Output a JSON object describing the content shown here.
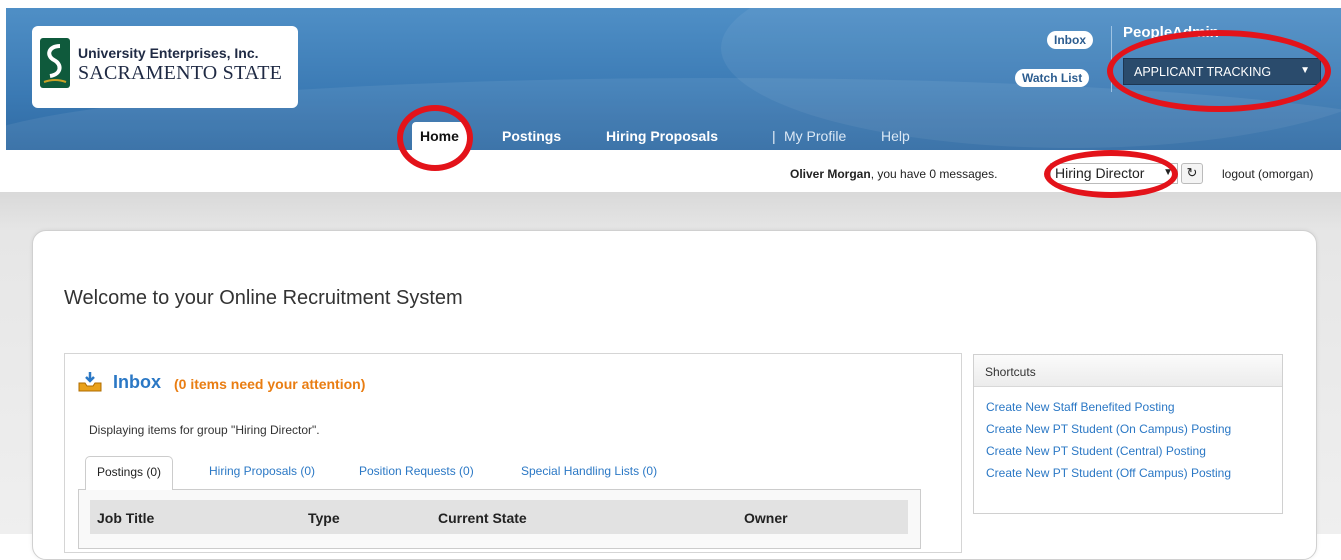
{
  "header": {
    "org_line1": "University Enterprises, Inc.",
    "org_line2": "SACRAMENTO STATE",
    "inbox_label": "Inbox",
    "watchlist_label": "Watch List",
    "brand": "PeopleAdmin",
    "module_select": "APPLICANT TRACKING"
  },
  "nav": {
    "home": "Home",
    "postings": "Postings",
    "hiring_proposals": "Hiring Proposals",
    "separator": "|",
    "my_profile": "My Profile",
    "help": "Help"
  },
  "userbar": {
    "user_name": "Oliver Morgan",
    "message_text": ", you have 0 messages.",
    "role": "Hiring Director",
    "refresh_glyph": "↻",
    "logout": "logout (omorgan)"
  },
  "main": {
    "welcome": "Welcome to your Online Recruitment System"
  },
  "inbox": {
    "title": "Inbox",
    "attention": "(0 items need your attention)",
    "display_note": "Displaying items for group \"Hiring Director\".",
    "tabs": [
      {
        "label": "Postings (0)"
      },
      {
        "label": "Hiring Proposals (0)"
      },
      {
        "label": "Position Requests (0)"
      },
      {
        "label": "Special Handling Lists (0)"
      }
    ],
    "columns": [
      "Job Title",
      "Type",
      "Current State",
      "Owner"
    ]
  },
  "shortcuts": {
    "title": "Shortcuts",
    "links": [
      "Create New Staff Benefited Posting",
      "Create New PT Student (On Campus) Posting",
      "Create New PT Student (Central) Posting",
      "Create New PT Student (Off Campus) Posting"
    ]
  },
  "colors": {
    "header_blue": "#3b7ab4",
    "link_blue": "#2b78c5",
    "attention_orange": "#e97d12",
    "annotation_red": "#e3131a"
  }
}
